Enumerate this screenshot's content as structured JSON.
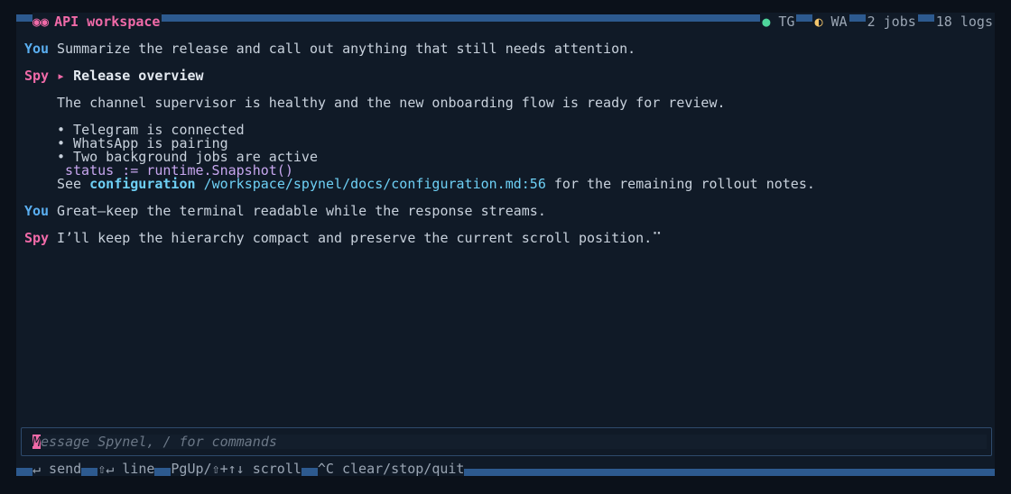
{
  "header": {
    "title_icon": "◉◉",
    "title": "API workspace",
    "status": [
      {
        "icon": "●",
        "label": "TG",
        "color": "#4fd69c"
      },
      {
        "icon": "◐",
        "label": "WA",
        "color": "#f1c46b"
      },
      {
        "icon": "",
        "label": "2 jobs"
      },
      {
        "icon": "",
        "label": "18 logs"
      }
    ]
  },
  "conversation": {
    "m1": {
      "role": "You",
      "text": "Summarize the release and call out anything that still needs attention."
    },
    "m2": {
      "role": "Spy",
      "heading_marker": "▸",
      "heading": "Release overview",
      "paragraph": "The channel supervisor is healthy and the new onboarding flow is ready for review.",
      "bullets": [
        "• Telegram is connected",
        "• WhatsApp is pairing",
        "• Two background jobs are active"
      ],
      "code": "status := runtime.Snapshot()",
      "see_prefix": "See",
      "link_label": "configuration",
      "link_path": "/workspace/spynel/docs/configuration.md:56",
      "see_suffix": "for the remaining rollout notes."
    },
    "m3": {
      "role": "You",
      "text": "Great—keep the terminal readable while the response streams."
    },
    "m4": {
      "role": "Spy",
      "text": "I’ll keep the hierarchy compact and preserve the current scroll position.",
      "spinner": "⠉"
    }
  },
  "input": {
    "caret_char": "M",
    "placeholder": "essage Spynel, / for commands"
  },
  "footer": {
    "hints": [
      "↵ send",
      "⇧↵ line",
      "PgUp/⇧+↑↓ scroll",
      "^C clear/stop/quit"
    ]
  },
  "colors": {
    "accent": "#f06aa8",
    "user": "#5aaef0",
    "link": "#6ed0f5",
    "code": "#c7a6ef",
    "bar": "#2d5a8f"
  }
}
